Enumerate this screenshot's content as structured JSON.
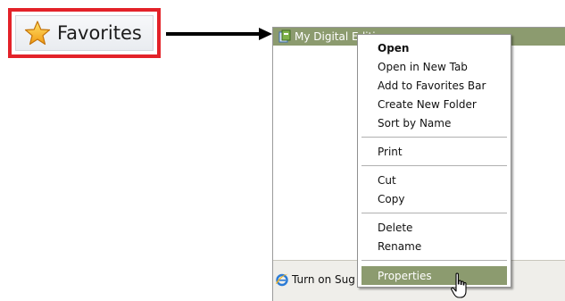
{
  "favorites_button": {
    "label": "Favorites",
    "icon": "star-icon"
  },
  "panel": {
    "item": {
      "label": "My Digital Edition",
      "icon": "page-icon"
    },
    "footer": {
      "label": "Turn on Sug",
      "icon": "internet-explorer-icon"
    }
  },
  "context_menu": {
    "items": [
      {
        "label": "Open"
      },
      {
        "label": "Open in New Tab"
      },
      {
        "label": "Add to Favorites Bar"
      },
      {
        "label": "Create New Folder"
      },
      {
        "label": "Sort by Name"
      },
      {
        "label": "Print"
      },
      {
        "label": "Cut"
      },
      {
        "label": "Copy"
      },
      {
        "label": "Delete"
      },
      {
        "label": "Rename"
      },
      {
        "label": "Properties"
      }
    ]
  },
  "colors": {
    "highlight": "#8c9b6f",
    "callout_border": "#e32229"
  }
}
